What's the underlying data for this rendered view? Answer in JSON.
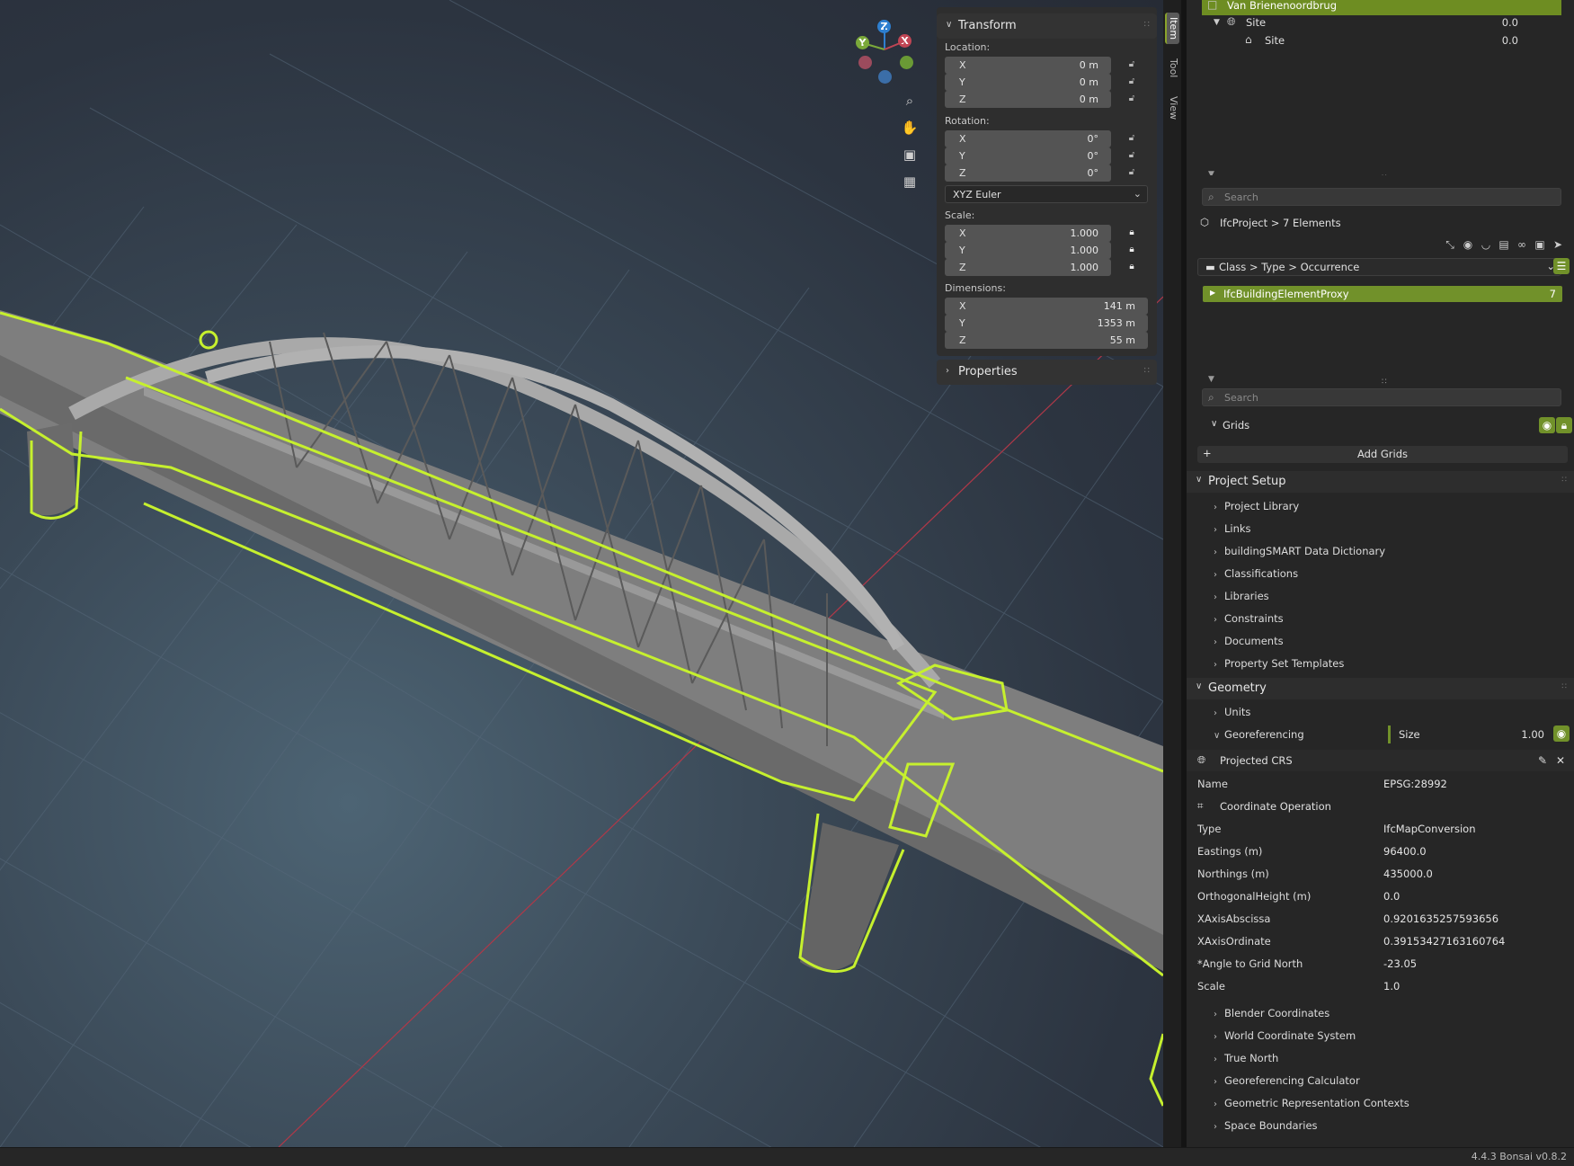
{
  "viewport": {
    "gizmo": {
      "z": "Z",
      "y": "Y",
      "x": "X"
    },
    "nav_icons": [
      "zoom-icon",
      "pan-hand-icon",
      "camera-icon",
      "ortho-grid-icon"
    ]
  },
  "npanel": {
    "transform_title": "Transform",
    "location_label": "Location:",
    "location": [
      {
        "axis": "X",
        "value": "0 m"
      },
      {
        "axis": "Y",
        "value": "0 m"
      },
      {
        "axis": "Z",
        "value": "0 m"
      }
    ],
    "rotation_label": "Rotation:",
    "rotation": [
      {
        "axis": "X",
        "value": "0°"
      },
      {
        "axis": "Y",
        "value": "0°"
      },
      {
        "axis": "Z",
        "value": "0°"
      }
    ],
    "rotation_mode": "XYZ Euler",
    "scale_label": "Scale:",
    "scale": [
      {
        "axis": "X",
        "value": "1.000"
      },
      {
        "axis": "Y",
        "value": "1.000"
      },
      {
        "axis": "Z",
        "value": "1.000"
      }
    ],
    "dimensions_label": "Dimensions:",
    "dimensions": [
      {
        "axis": "X",
        "value": "141 m"
      },
      {
        "axis": "Y",
        "value": "1353 m"
      },
      {
        "axis": "Z",
        "value": "55 m"
      }
    ],
    "properties_title": "Properties",
    "tabs": [
      "Item",
      "Tool",
      "View"
    ]
  },
  "outliner": {
    "rows": [
      {
        "label": "Van Brienenoordbrug",
        "value": ""
      },
      {
        "label": "Site",
        "value": "0.0"
      },
      {
        "label": "Site",
        "value": "0.0"
      }
    ]
  },
  "panel": {
    "search_placeholder": "Search",
    "breadcrumb": "IfcProject > 7 Elements",
    "grouping": "Class > Type > Occurrence",
    "class_row": {
      "label": "IfcBuildingElementProxy",
      "count": "7"
    },
    "search2_placeholder": "Search",
    "grids_label": "Grids",
    "add_grids": "Add Grids",
    "project_setup": "Project Setup",
    "project_setup_items": [
      "Project Library",
      "Links",
      "buildingSMART Data Dictionary",
      "Classifications",
      "Libraries",
      "Constraints",
      "Documents",
      "Property Set Templates"
    ],
    "geometry": "Geometry",
    "units": "Units",
    "georeferencing": "Georeferencing",
    "size_label": "Size",
    "size_value": "1.00",
    "projected_crs": "Projected CRS",
    "crs_name_key": "Name",
    "crs_name_value": "EPSG:28992",
    "coord_op": "Coordinate Operation",
    "kv": [
      {
        "k": "Type",
        "v": "IfcMapConversion"
      },
      {
        "k": "Eastings (m)",
        "v": "96400.0"
      },
      {
        "k": "Northings (m)",
        "v": "435000.0"
      },
      {
        "k": "OrthogonalHeight (m)",
        "v": "0.0"
      },
      {
        "k": "XAxisAbscissa",
        "v": "0.9201635257593656"
      },
      {
        "k": "XAxisOrdinate",
        "v": "0.39153427163160764"
      },
      {
        "k": "*Angle to Grid North",
        "v": "-23.05"
      },
      {
        "k": "Scale",
        "v": "1.0"
      }
    ],
    "geo_subs": [
      "Blender Coordinates",
      "World Coordinate System",
      "True North",
      "Georeferencing Calculator",
      "Geometric Representation Contexts",
      "Space Boundaries"
    ]
  },
  "status": {
    "version": "4.4.3   Bonsai v0.8.2"
  },
  "colors": {
    "accent": "#71912a",
    "selection_outline": "#c6f02e",
    "viewport_bg": "#3b4a58"
  }
}
